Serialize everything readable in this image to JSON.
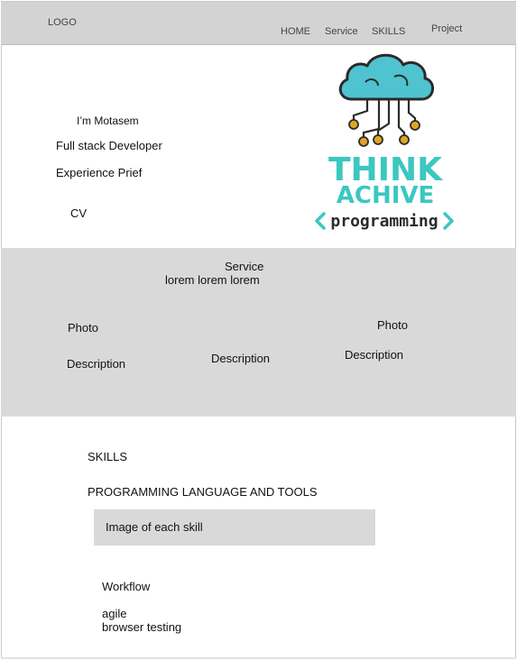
{
  "nav": {
    "logo": "LOGO",
    "home": "HOME",
    "service": "Service",
    "skills": "SKILLS",
    "project": "Project"
  },
  "hero": {
    "greeting": "I’m Motasem",
    "role": "Full stack Developer",
    "experience": "Experience Prief",
    "cv": "CV"
  },
  "brand_logo": {
    "line1": "THINK",
    "line2": "ACHIVE",
    "line3": "programming",
    "colors": {
      "teal": "#3cc7c1",
      "cloud": "#4fc3cf",
      "node": "#e0a623",
      "dark": "#2b2b2b"
    },
    "icon": "cloud-circuit-icon"
  },
  "service": {
    "title": "Service",
    "subtitle": "lorem  lorem  lorem",
    "photo_left": "Photo",
    "photo_right": "Photo",
    "desc_left": "Description",
    "desc_mid": "Description",
    "desc_right": "Description"
  },
  "skills": {
    "title": "SKILLS",
    "subtitle": "PROGRAMMING LANGUAGE  AND TOOLS",
    "image_box": "Image of each skill",
    "workflow_title": "Workflow",
    "workflow_items": [
      "agile",
      "browser testing"
    ]
  }
}
